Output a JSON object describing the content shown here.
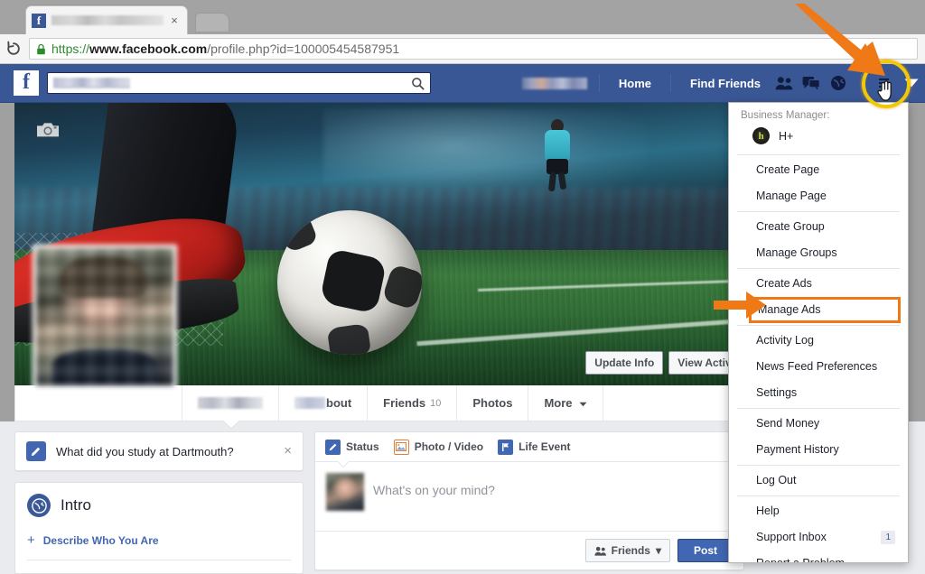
{
  "browser": {
    "tab": {
      "title_blurred": true,
      "favicon": "facebook-favicon",
      "close": "×"
    },
    "reload_icon": "reload-icon",
    "new_tab_icon": "new-tab-button",
    "url": {
      "lock": "lock-icon",
      "scheme": "https://",
      "host": "www.facebook.com",
      "path": "/profile.php?id=100005454587951"
    }
  },
  "fbbar": {
    "logo": "f",
    "search_placeholder": "",
    "search_icon": "search-icon",
    "nav": {
      "home": "Home",
      "find_friends": "Find Friends",
      "friend_requests_icon": "friend-requests-icon",
      "messages_icon": "messages-icon",
      "notifications_icon": "globe-notifications-icon",
      "privacy_icon": "privacy-shortcuts-icon",
      "account_caret_icon": "account-dropdown-caret-icon"
    }
  },
  "cover": {
    "camera_icon": "camera-icon",
    "update_info": "Update Info",
    "view_activity_log": "View Activity Log"
  },
  "profile_tabs": [
    {
      "label": "",
      "blurred": true,
      "active": true
    },
    {
      "label": "bout",
      "blurred_prefix": true
    },
    {
      "label": "Friends",
      "count": "10"
    },
    {
      "label": "Photos"
    },
    {
      "label": "More",
      "caret": true
    }
  ],
  "left_column": {
    "study_prompt": {
      "icon": "pencil-icon",
      "text": "What did you study at Dartmouth?",
      "close": "×"
    },
    "intro": {
      "icon": "globe-icon",
      "title": "Intro",
      "action_plus": "+",
      "action_label": "Describe Who You Are"
    }
  },
  "composer": {
    "tabs": [
      {
        "icon": "status-pencil-icon",
        "label": "Status"
      },
      {
        "icon": "photo-video-icon",
        "label": "Photo / Video"
      },
      {
        "icon": "life-event-flag-icon",
        "label": "Life Event"
      }
    ],
    "placeholder": "What's on your mind?",
    "audience": {
      "icon": "friends-audience-icon",
      "label": "Friends",
      "caret": "▾"
    },
    "post_label": "Post"
  },
  "dropdown": {
    "business_manager_label": "Business Manager:",
    "business_account": {
      "avatar_letter": "h",
      "name": "H+"
    },
    "groups": [
      [
        {
          "label": "Create Page"
        },
        {
          "label": "Manage Page"
        }
      ],
      [
        {
          "label": "Create Group"
        },
        {
          "label": "Manage Groups"
        }
      ],
      [
        {
          "label": "Create Ads"
        },
        {
          "label": "Manage Ads",
          "highlighted": true
        }
      ],
      [
        {
          "label": "Activity Log"
        },
        {
          "label": "News Feed Preferences"
        },
        {
          "label": "Settings"
        }
      ],
      [
        {
          "label": "Send Money"
        },
        {
          "label": "Payment History"
        }
      ],
      [
        {
          "label": "Log Out"
        }
      ],
      [
        {
          "label": "Help"
        },
        {
          "label": "Support Inbox",
          "badge": "1"
        },
        {
          "label": "Report a Problem"
        }
      ]
    ]
  },
  "annotations": {
    "arrow_color": "#ef7916",
    "circle_color": "#f0c808",
    "highlight_target": "Manage Ads",
    "circle_target": "account-dropdown-caret-icon"
  }
}
